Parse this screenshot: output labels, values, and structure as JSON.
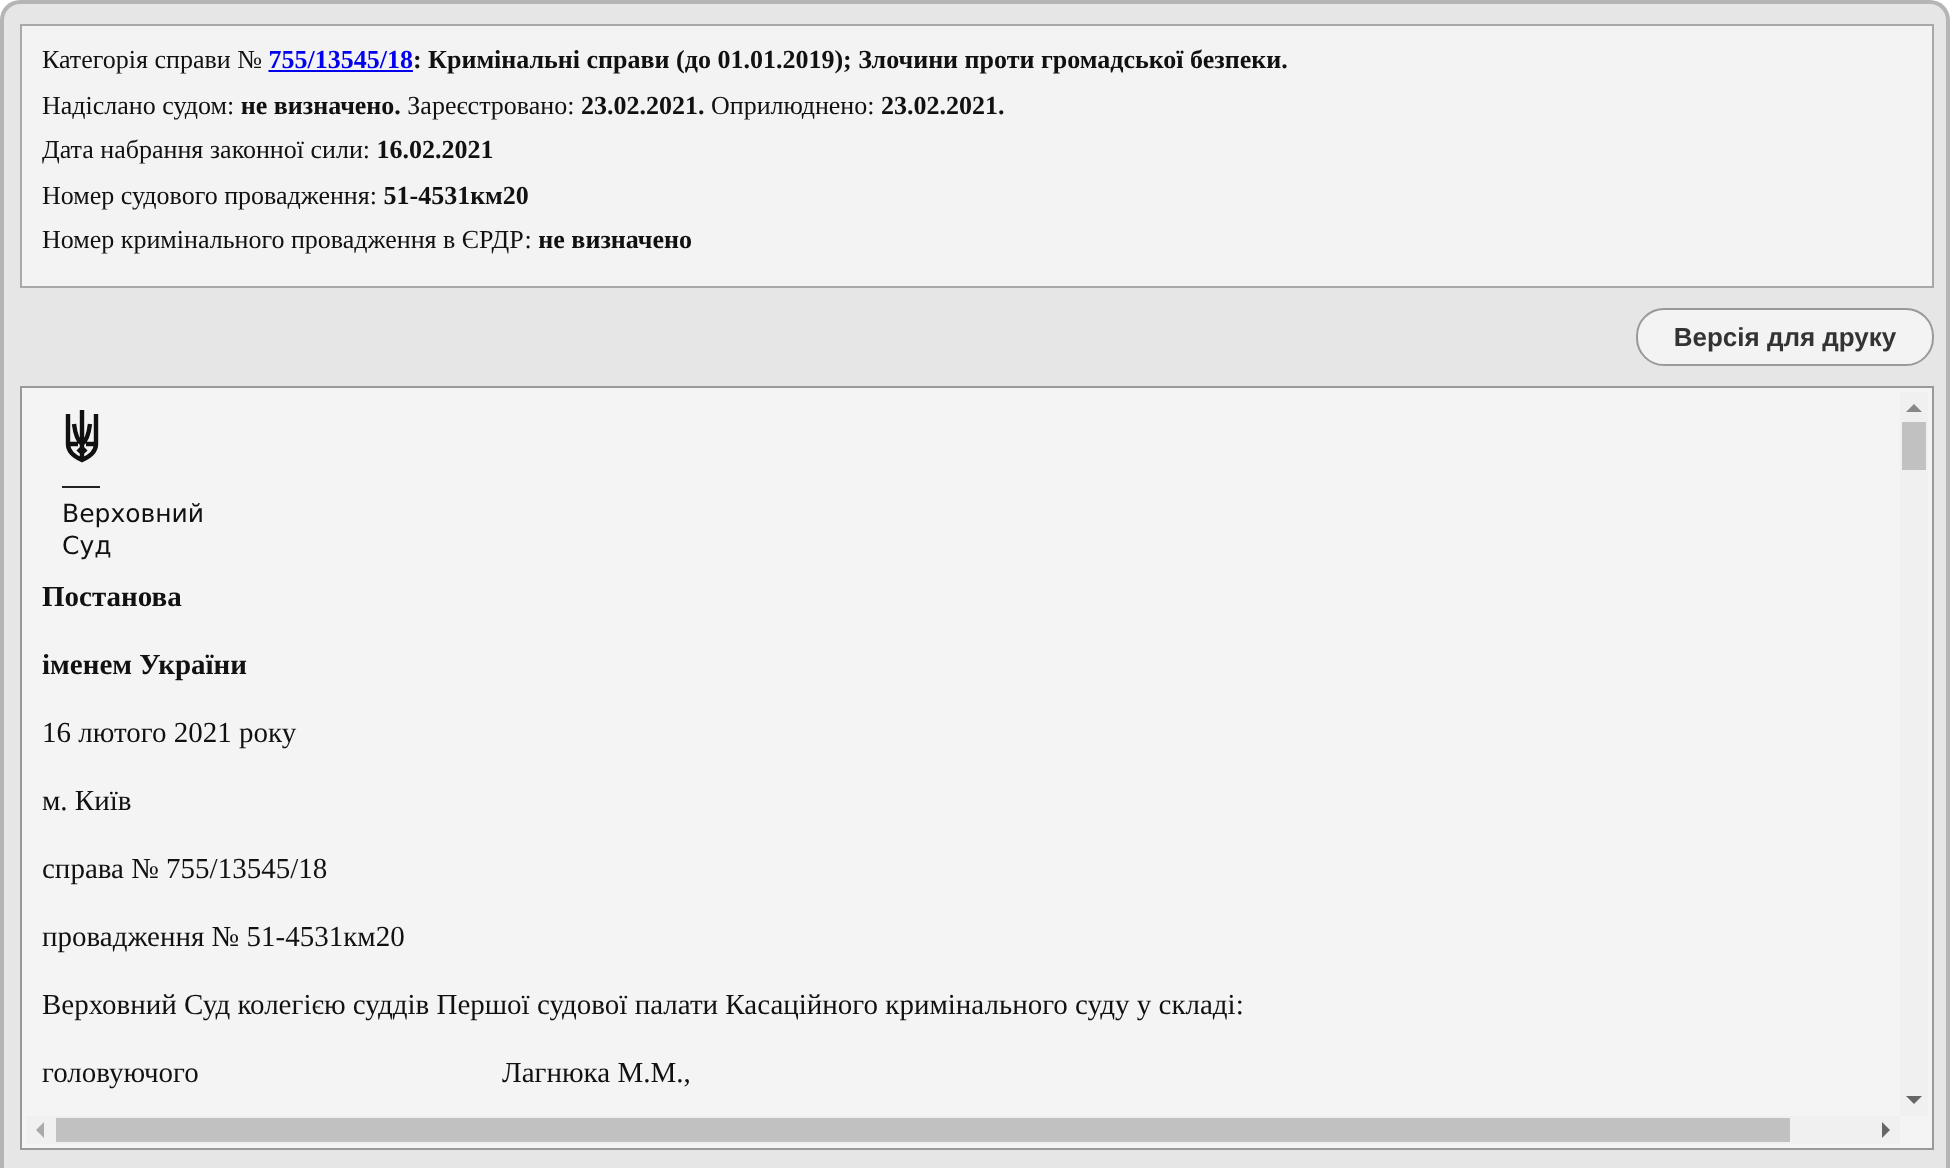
{
  "info": {
    "category": {
      "label": "Категорія справи №",
      "link": "755/13545/18",
      "value": ": Кримінальні справи (до 01.01.2019); Злочини проти громадської безпеки."
    },
    "lines": [
      "Надіслано судом: **не визначено.** Зареєстровано: **23.02.2021.** Оприлюднено: **23.02.2021.**",
      "Дата набрання законної сили: **16.02.2021**",
      "Номер судового провадження: **51-4531км20**",
      "Номер кримінального провадження в ЄРДР: **не визначено**"
    ]
  },
  "print_button": "Версія для друку",
  "document": {
    "court_logo": [
      "Верховний",
      "Суд"
    ],
    "paragraphs": [
      {
        "kind": "bold",
        "text": "Постанова"
      },
      {
        "kind": "bold",
        "text": "іменем України"
      },
      {
        "kind": "normal",
        "text": "16 лютого 2021 року"
      },
      {
        "kind": "normal",
        "text": "м. Київ"
      },
      {
        "kind": "normal",
        "text": "справа № 755/13545/18"
      },
      {
        "kind": "normal",
        "text": "провадження № 51-4531км20"
      },
      {
        "kind": "normal",
        "text": "Верховний Суд колегією суддів Першої  судової палати Касаційного кримінального суду  у складі:"
      },
      {
        "kind": "judge",
        "role": "головуючого",
        "text": "Лагнюка М.М.,"
      }
    ]
  }
}
